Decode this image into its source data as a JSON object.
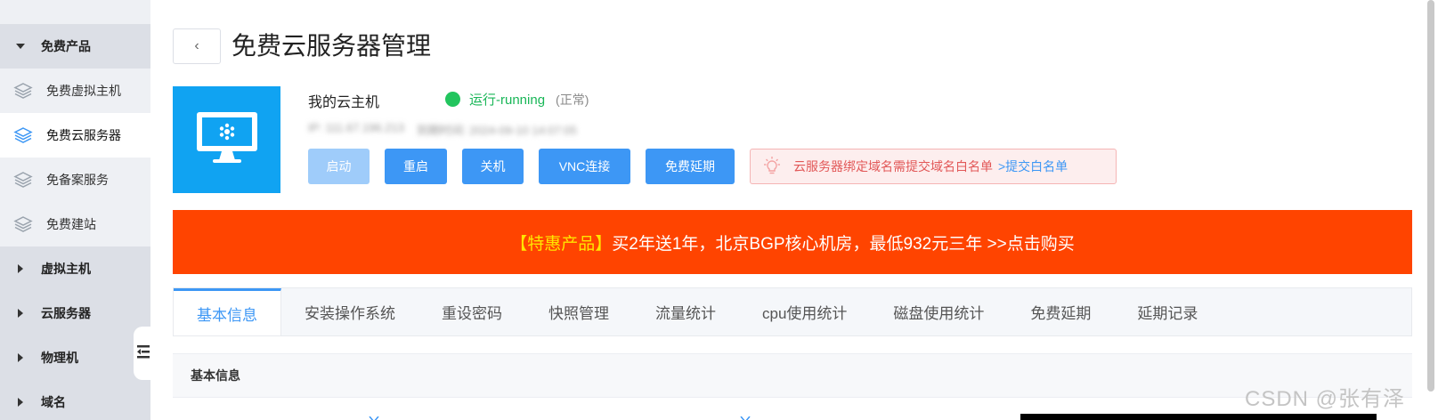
{
  "sidebar": {
    "groups": [
      {
        "label": "免费产品",
        "expanded": true
      },
      {
        "label": "虚拟主机",
        "expanded": false
      },
      {
        "label": "云服务器",
        "expanded": false
      },
      {
        "label": "物理机",
        "expanded": false
      },
      {
        "label": "域名",
        "expanded": false
      }
    ],
    "items": [
      {
        "label": "免费虚拟主机",
        "icon": "layers-icon",
        "active": false
      },
      {
        "label": "免费云服务器",
        "icon": "layers-icon",
        "active": true
      },
      {
        "label": "免备案服务",
        "icon": "layers-icon",
        "active": false
      },
      {
        "label": "免费建站",
        "icon": "layers-icon",
        "active": false
      }
    ]
  },
  "header": {
    "back_icon": "‹",
    "title": "免费云服务器管理"
  },
  "server": {
    "name": "我的云主机",
    "status_text": "运行-running",
    "status_note": "(正常)",
    "status_color": "#22c55e",
    "blurred_ip": "IP: 111.67.196.213",
    "blurred_expire": "到期时间: 2024-09-10 14:07:05"
  },
  "actions": {
    "start": "启动",
    "restart": "重启",
    "shutdown": "关机",
    "vnc": "VNC连接",
    "extend": "免费延期"
  },
  "notice": {
    "message": "云服务器绑定域名需提交域名白名单",
    "link": ">提交白名单"
  },
  "promo": {
    "tag": "【特惠产品】",
    "text": " 买2年送1年，北京BGP核心机房，最低932元三年 >>点击购买"
  },
  "tabs": [
    {
      "label": "基本信息",
      "active": true
    },
    {
      "label": "安装操作系统",
      "active": false
    },
    {
      "label": "重设密码",
      "active": false
    },
    {
      "label": "快照管理",
      "active": false
    },
    {
      "label": "流量统计",
      "active": false
    },
    {
      "label": "cpu使用统计",
      "active": false
    },
    {
      "label": "磁盘使用统计",
      "active": false
    },
    {
      "label": "免费延期",
      "active": false
    },
    {
      "label": "延期记录",
      "active": false
    }
  ],
  "section": {
    "title": "基本信息"
  },
  "watermark": "CSDN @张有泽",
  "colors": {
    "accent": "#3d97f5",
    "promo": "#ff4400",
    "thumb": "#10a3f2"
  }
}
